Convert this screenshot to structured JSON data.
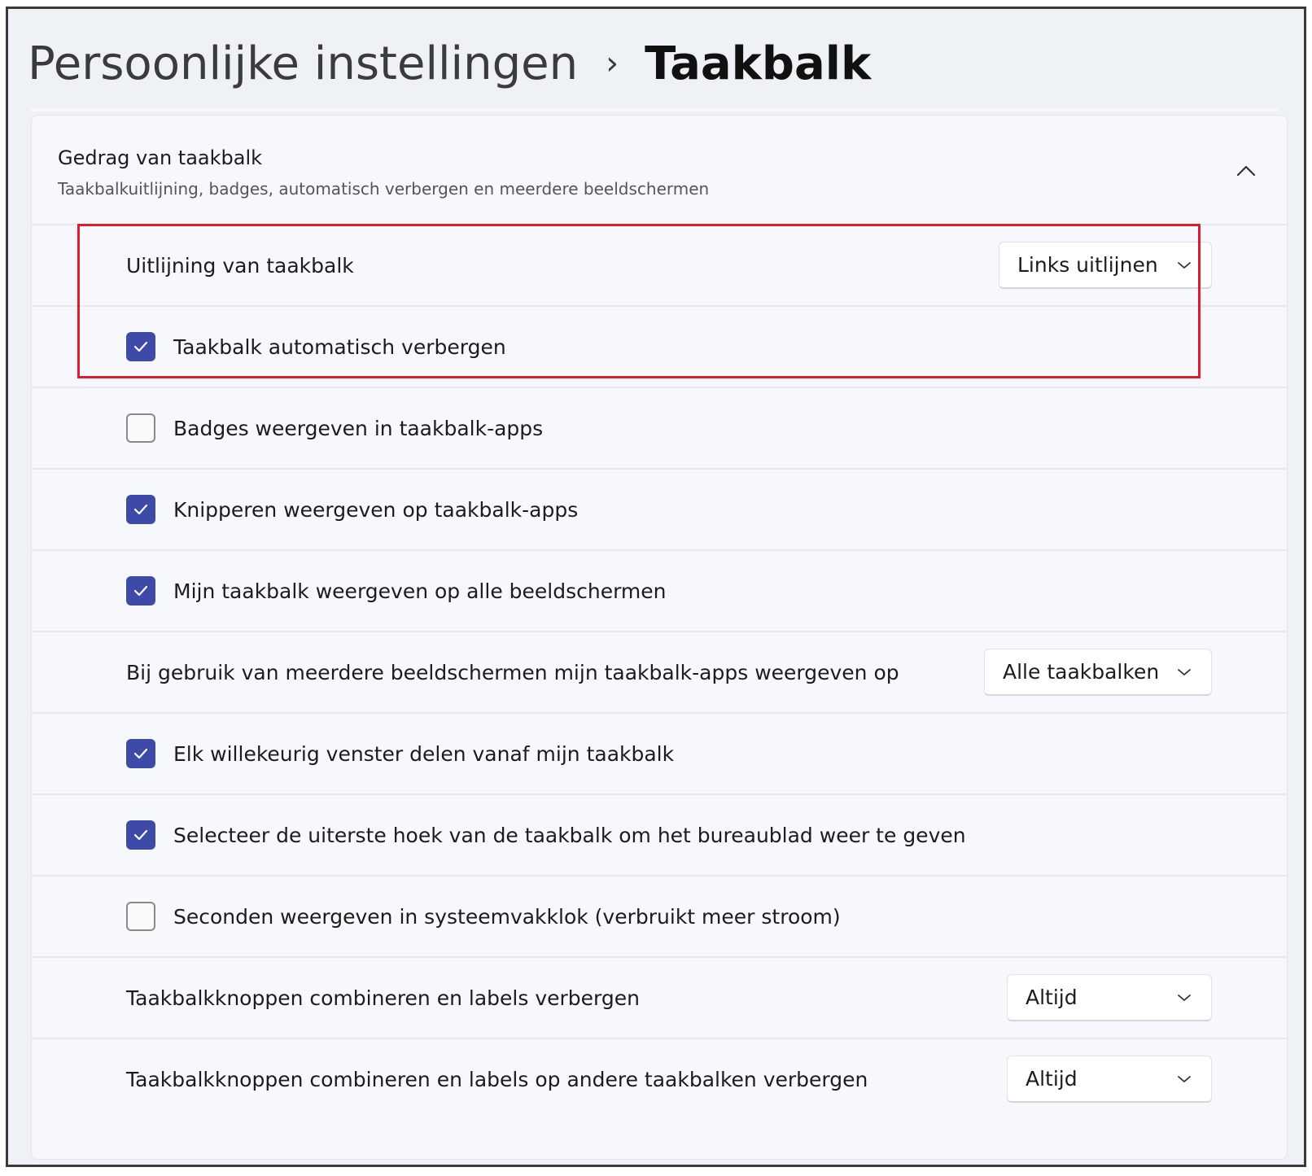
{
  "breadcrumb": {
    "parent": "Persoonlijke instellingen",
    "separator": "›",
    "current": "Taakbalk"
  },
  "section": {
    "title": "Gedrag van taakbalk",
    "subtitle": "Taakbalkuitlijning, badges, automatisch verbergen en meerdere beeldschermen",
    "expanded": true,
    "chevron_icon": "chevron-up-icon"
  },
  "rows": [
    {
      "type": "dropdown",
      "label": "Uitlijning van taakbalk",
      "value": "Links uitlijnen",
      "highlighted": true
    },
    {
      "type": "checkbox",
      "label": "Taakbalk automatisch verbergen",
      "checked": true,
      "highlighted": true
    },
    {
      "type": "checkbox",
      "label": "Badges weergeven in taakbalk-apps",
      "checked": false
    },
    {
      "type": "checkbox",
      "label": "Knipperen weergeven op taakbalk-apps",
      "checked": true
    },
    {
      "type": "checkbox",
      "label": "Mijn taakbalk weergeven op alle beeldschermen",
      "checked": true
    },
    {
      "type": "dropdown",
      "label": "Bij gebruik van meerdere beeldschermen mijn taakbalk-apps weergeven op",
      "value": "Alle taakbalken"
    },
    {
      "type": "checkbox",
      "label": "Elk willekeurig venster delen vanaf mijn taakbalk",
      "checked": true
    },
    {
      "type": "checkbox",
      "label": "Selecteer de uiterste hoek van de taakbalk om het bureaublad weer te geven",
      "checked": true
    },
    {
      "type": "checkbox",
      "label": "Seconden weergeven in systeemvakklok (verbruikt meer stroom)",
      "checked": false
    },
    {
      "type": "dropdown",
      "label": "Taakbalkknoppen combineren en labels verbergen",
      "value": "Altijd"
    },
    {
      "type": "dropdown",
      "label": "Taakbalkknoppen combineren en labels op andere taakbalken verbergen",
      "value": "Altijd"
    }
  ],
  "colors": {
    "checkbox_checked": "#3e4aa8",
    "highlight_border": "#e01b2f",
    "background": "#eef2f7"
  }
}
